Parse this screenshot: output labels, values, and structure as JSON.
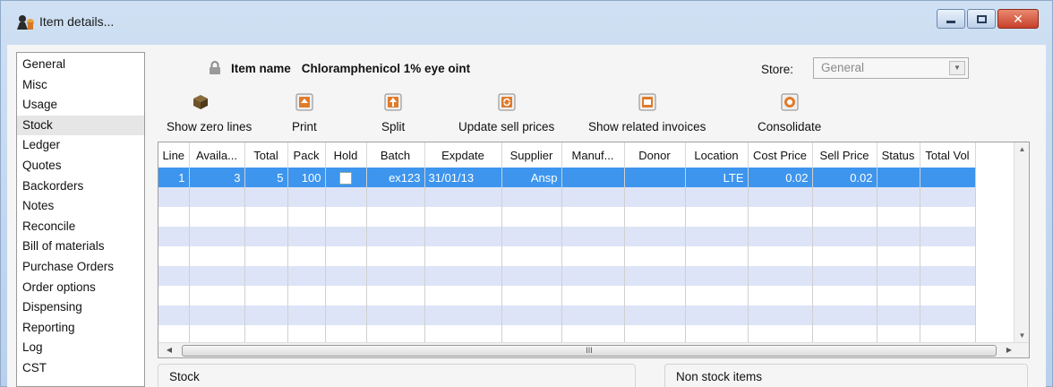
{
  "window": {
    "title": "Item details...",
    "controls": [
      "minimize",
      "maximize",
      "close"
    ]
  },
  "sidebar": {
    "items": [
      {
        "label": "General"
      },
      {
        "label": "Misc"
      },
      {
        "label": "Usage"
      },
      {
        "label": "Stock",
        "selected": true
      },
      {
        "label": "Ledger"
      },
      {
        "label": "Quotes"
      },
      {
        "label": "Backorders"
      },
      {
        "label": "Notes"
      },
      {
        "label": "Reconcile"
      },
      {
        "label": "Bill of materials"
      },
      {
        "label": "Purchase Orders"
      },
      {
        "label": "Order options"
      },
      {
        "label": "Dispensing"
      },
      {
        "label": "Reporting"
      },
      {
        "label": "Log"
      },
      {
        "label": "CST"
      }
    ]
  },
  "item": {
    "label": "Item name",
    "value": "Chloramphenicol 1% eye oint"
  },
  "store": {
    "label": "Store:",
    "value": "General"
  },
  "toolbar": {
    "show_zero_lines": "Show zero lines",
    "print": "Print",
    "split": "Split",
    "update_sell_prices": "Update sell prices",
    "show_related_invoices": "Show related invoices",
    "consolidate": "Consolidate"
  },
  "table": {
    "columns": [
      "Line",
      "Availa...",
      "Total",
      "Pack",
      "Hold",
      "Batch",
      "Expdate",
      "Supplier",
      "Manuf...",
      "Donor",
      "Location",
      "Cost Price",
      "Sell Price",
      "Status",
      "Total Vol"
    ],
    "rows": [
      {
        "line": "1",
        "available": "3",
        "total": "5",
        "pack": "100",
        "hold": false,
        "batch": "ex123",
        "expdate": "31/01/13",
        "supplier": "Ansp",
        "manufacturer": "",
        "donor": "",
        "location": "LTE",
        "cost_price": "0.02",
        "sell_price": "0.02",
        "status": "",
        "total_vol": ""
      }
    ],
    "scroll_thumb_label": "III"
  },
  "panels": {
    "stock": "Stock",
    "non_stock": "Non stock items"
  },
  "colors": {
    "selection": "#3d95ee",
    "stripe": "#dde4f7",
    "window_chrome": "#c4d8ee"
  }
}
